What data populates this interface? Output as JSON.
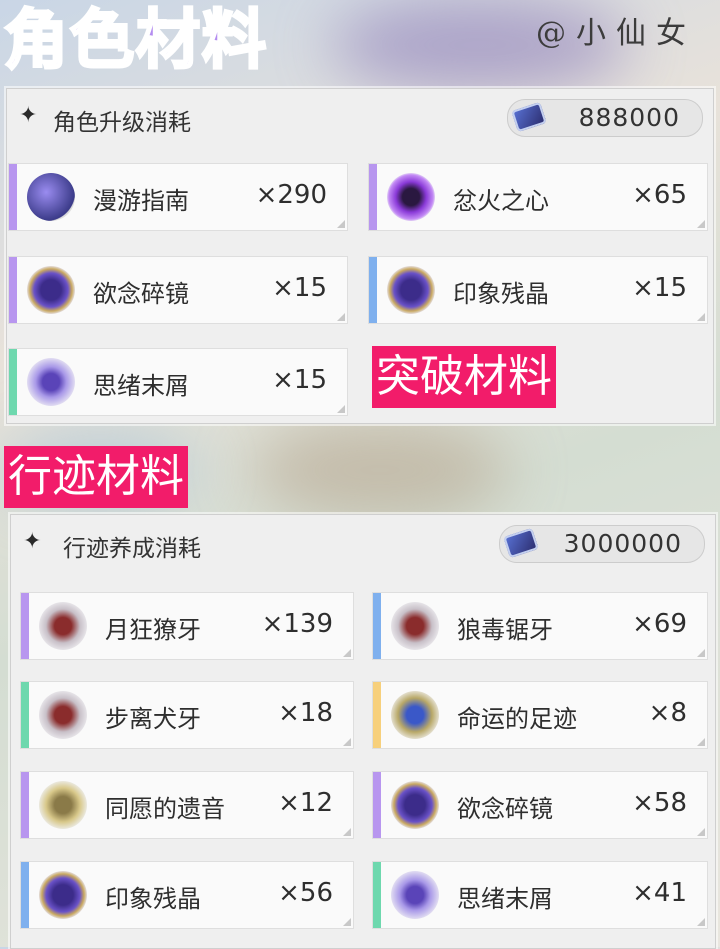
{
  "header": {
    "title": "角色材料",
    "watermark": "@小仙女"
  },
  "section1": {
    "title": "角色升级消耗",
    "currency_icon": "credit-icon",
    "currency": "888000",
    "items": [
      {
        "name": "漫游指南",
        "qty": "×290",
        "rarity": "purple",
        "icon": "book-icon"
      },
      {
        "name": "忿火之心",
        "qty": "×65",
        "rarity": "purple",
        "icon": "ember-orb-icon"
      },
      {
        "name": "欲念碎镜",
        "qty": "×15",
        "rarity": "purple",
        "icon": "crystal-icon"
      },
      {
        "name": "印象残晶",
        "qty": "×15",
        "rarity": "blue",
        "icon": "crystal-icon"
      },
      {
        "name": "思绪末屑",
        "qty": "×15",
        "rarity": "green",
        "icon": "shard-icon"
      }
    ]
  },
  "labels": {
    "breakthrough": "突破材料",
    "trace": "行迹材料"
  },
  "section2": {
    "title": "行迹养成消耗",
    "currency_icon": "credit-icon",
    "currency": "3000000",
    "items": [
      {
        "name": "月狂獠牙",
        "qty": "×139",
        "rarity": "purple",
        "icon": "fang-icon"
      },
      {
        "name": "狼毒锯牙",
        "qty": "×69",
        "rarity": "blue",
        "icon": "fang-icon"
      },
      {
        "name": "步离犬牙",
        "qty": "×18",
        "rarity": "green",
        "icon": "fang-icon"
      },
      {
        "name": "命运的足迹",
        "qty": "×8",
        "rarity": "gold",
        "icon": "compass-icon"
      },
      {
        "name": "同愿的遗音",
        "qty": "×12",
        "rarity": "purple",
        "icon": "relic-icon"
      },
      {
        "name": "欲念碎镜",
        "qty": "×58",
        "rarity": "purple",
        "icon": "crystal-icon"
      },
      {
        "name": "印象残晶",
        "qty": "×56",
        "rarity": "blue",
        "icon": "crystal-icon"
      },
      {
        "name": "思绪末屑",
        "qty": "×41",
        "rarity": "green",
        "icon": "shard-icon"
      }
    ]
  },
  "colors": {
    "purple": "#b896ef",
    "blue": "#7fb0ee",
    "green": "#6ed8ae",
    "gold": "#f7d07c",
    "label_bg": "#f21c6a"
  }
}
